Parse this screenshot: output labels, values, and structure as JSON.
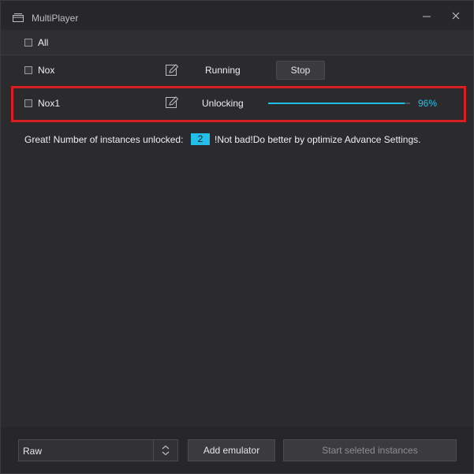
{
  "titlebar": {
    "title": "MultiPlayer",
    "app_icon": "window-stack-icon",
    "minimize_icon": "minimize-icon",
    "close_icon": "close-icon"
  },
  "select_all": {
    "label": "All",
    "checked": false
  },
  "instances": [
    {
      "name": "Nox",
      "status": "Running",
      "action_label": "Stop",
      "checked": false
    },
    {
      "name": "Nox1",
      "status": "Unlocking",
      "progress_percent": 96,
      "progress_label": "96%",
      "checked": false
    }
  ],
  "message": {
    "prefix": "Great! Number of instances unlocked:",
    "count": "2",
    "suffix": "!Not bad!Do better by optimize Advance Settings."
  },
  "footer": {
    "mode_select_value": "Raw",
    "add_label": "Add emulator",
    "start_label": "Start seleted instances"
  },
  "colors": {
    "accent": "#22c0e8",
    "highlight": "#d91f1f",
    "background": "#2b2b2e"
  }
}
